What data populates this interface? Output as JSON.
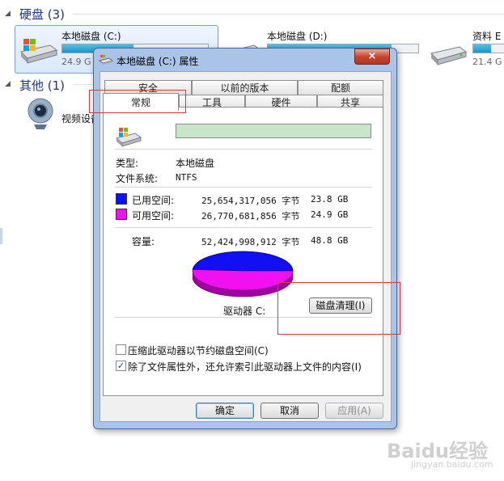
{
  "explorer": {
    "hard_disk_group": "硬盘 (3)",
    "other_group": "其他 (1)",
    "drives": [
      {
        "label": "本地磁盘 (C:)",
        "free_text": "24.9 G",
        "used_fraction": 0.49
      },
      {
        "label": "本地磁盘 (D:)",
        "used_fraction": 0.82
      },
      {
        "label": "资料 E",
        "free_text": "21.4 G",
        "used_fraction": 0.55
      }
    ],
    "video_device_label": "视频设备"
  },
  "dialog": {
    "title": "本地磁盘 (C:) 属性",
    "close_glyph": "×",
    "tabs_row1": [
      "安全",
      "以前的版本",
      "配额"
    ],
    "tabs_row2": [
      "常规",
      "工具",
      "硬件",
      "共享"
    ],
    "active_tab": "常规",
    "general": {
      "name_value": "",
      "type_label": "类型:",
      "type_value": "本地磁盘",
      "fs_label": "文件系统:",
      "fs_value": "NTFS",
      "used": {
        "label": "已用空间:",
        "bytes": "25,654,317,056 字节",
        "size": "23.8 GB",
        "color": "#1010f0"
      },
      "free": {
        "label": "可用空间:",
        "bytes": "26,770,681,856 字节",
        "size": "24.9 GB",
        "color": "#f010f0"
      },
      "capacity": {
        "label": "容量:",
        "bytes": "52,424,998,912 字节",
        "size": "48.8 GB"
      },
      "used_fraction": 0.489,
      "drive_label": "驱动器 C:",
      "cleanup_button": "磁盘清理(I)",
      "compress_label": "压缩此驱动器以节约磁盘空间(C)",
      "compress_checked": false,
      "index_label": "除了文件属性外，还允许索引此驱动器上文件的内容(I)",
      "index_checked": true
    },
    "buttons": {
      "ok": "确定",
      "cancel": "取消",
      "apply": "应用(A)"
    }
  },
  "watermark": {
    "brand": "Baidu经验",
    "url": "jingyan.baidu.com"
  }
}
